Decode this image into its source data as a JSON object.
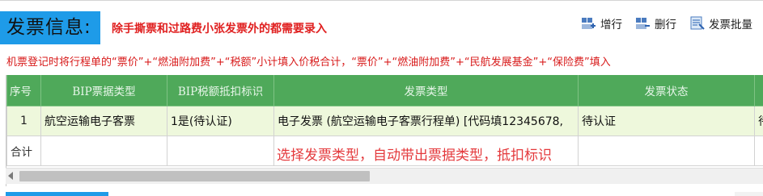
{
  "section": {
    "title": "发票信息:",
    "note": "除手撕票和过路费小张发票外的都需要录入"
  },
  "toolbar": {
    "add_row": "增行",
    "delete_row": "删行",
    "batch": "发票批量"
  },
  "instruction": "机票登记时将行程单的“票价”+“燃油附加费”+“税额”小计填入价税合计，“票价”+“燃油附加费”+“民航发展基金”+“保险费”填入",
  "table": {
    "headers": [
      "序号",
      "BIP票据类型",
      "BIP税额抵扣标识",
      "发票类型",
      "发票状态",
      ""
    ],
    "row": {
      "index": "1",
      "bip_type": "航空运输电子客票",
      "deduct_flag": "1是(待认证)",
      "invoice_type": "电子发票 (航空运输电子客票行程单) [代码填12345678,",
      "status": "待认证",
      "extra": "待"
    },
    "total_label": "合计"
  },
  "annotation": "选择发票类型，自动带出票据类型，抵扣标识",
  "colors": {
    "accent_blue": "#1e9be8",
    "header_green": "#4fa95a",
    "row_highlight": "#eef8dc",
    "note_red": "#e02020",
    "underline_magenta": "#d020c8"
  }
}
